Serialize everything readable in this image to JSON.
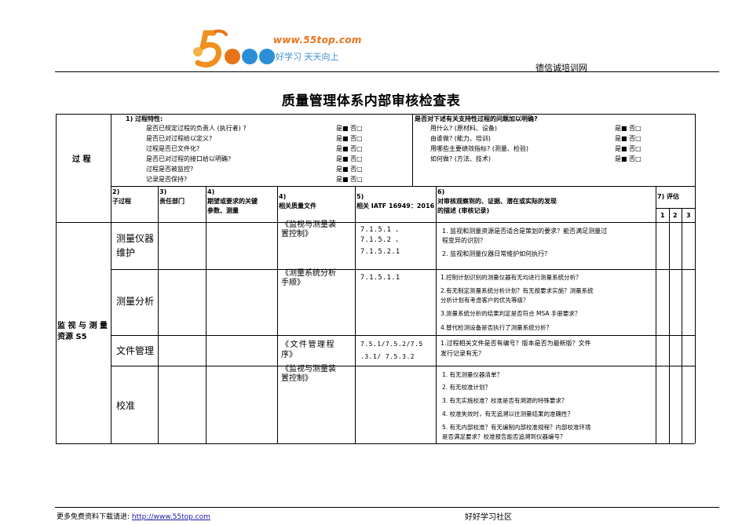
{
  "header": {
    "logo_url": "www.55top.com",
    "logo_slogan": "好好学习  天天向上",
    "site_name": "德信诚培训网"
  },
  "title": "质量管理体系内部审核检查表",
  "process_label": "过 程",
  "left_section": {
    "heading": "1) 过程特性:",
    "items": [
      {
        "q": "是否已规定过程的负责人 (执行者) ?",
        "a": "是■ 否□"
      },
      {
        "q": "是否已对过程给以定义?",
        "a": "是■ 否□"
      },
      {
        "q": "过程是否已文件化?",
        "a": "是■ 否□"
      },
      {
        "q": "是否已对过程的接口给以明确?",
        "a": "是■ 否□"
      },
      {
        "q": "过程是否被监控?",
        "a": "是■ 否□"
      },
      {
        "q": "记录是否保持?",
        "a": "是■ 否□"
      }
    ]
  },
  "right_section": {
    "heading": "是否对下述有关支持性过程的问题加以明确?",
    "items": [
      {
        "q": "用什么? (原材料、设备)",
        "a": "是■ 否□"
      },
      {
        "q": "由谁做? (能力、培训)",
        "a": "是■ 否□"
      },
      {
        "q": "用哪些主要绩效指标? (测量、检验)",
        "a": "是■ 否□"
      },
      {
        "q": "如何做? (方法、技术)",
        "a": "是■ 否□"
      }
    ]
  },
  "columns": {
    "c2": [
      "2)",
      "子过程"
    ],
    "c3": [
      "3)",
      "责任部门"
    ],
    "c4": [
      "4)",
      "期望或要求的关键",
      "参数、测量"
    ],
    "c4b": [
      "4)",
      "相关质量文件"
    ],
    "c5": [
      "5)",
      "相关 IATF 16949：2016"
    ],
    "c6": [
      "6)",
      "对审核观察到的、证据、潜在或实际的发现",
      "的描述 (审核记录)"
    ],
    "c7": "7) 评估",
    "scores": [
      "1",
      "2",
      "3"
    ]
  },
  "group": {
    "line1": "监 视 与 测 量",
    "line2": "资源 S5"
  },
  "rows": [
    {
      "sub": [
        "测量仪器",
        "维护"
      ],
      "doc": [
        "《监视与测量装",
        "置控制》"
      ],
      "clause": [
        "7.1.5.1        、",
        "7.1.5.2        、",
        "7.1.5.2.1"
      ],
      "findings": [
        "1.   监视和测量资源是否适合是策划的要求？能否满足测量过",
        "     程变异的识别？",
        "2.   监视和测量仪器日常维护如何执行？"
      ]
    },
    {
      "sub": [
        "测量分析"
      ],
      "doc": [
        "《测量系统分析",
        "手顺》"
      ],
      "clause": [
        "7.1.5.1.1"
      ],
      "findings": [
        "1.控制计划识别的测量仪器有无均进行测量系统分析？",
        "2.有无制定测量系统分析计划？有无按要求实施？测量系统",
        "分析计划有考虑客户的优先等级？",
        "3.测量系统分析的结果判定是否符合 MSA 手册要求？",
        "4.替代检测设备是否执行了测量系统分析？"
      ]
    },
    {
      "sub": [
        "文件管理"
      ],
      "doc": [
        "《文件管理程",
        "序》"
      ],
      "clause": [
        "7.5.1/7.5.2/7.5",
        ".3.1/ 7.5.3.2"
      ],
      "findings": [
        "   1.过程相关文件是否有编号？版本是否为最新版？文件",
        "发行记录有无？"
      ]
    },
    {
      "sub": [
        "校准"
      ],
      "doc": [
        "《监视与测量装",
        "置控制》"
      ],
      "clause": [],
      "findings": [
        "1.   有无测量仪器清单？",
        "2.   有无校准计划？",
        "3.   有无实施校准？校准是否有溯源的特殊要求？",
        "4.   校准失效时，有无追溯以往测量结果的准确性？",
        "5.   有无内部校准？有无编制内部校准规程？内部校准环境",
        "     是否满足要求？校准报告能否追溯到仪器编号？"
      ]
    }
  ],
  "footer": {
    "left_text": "更多免费资料下载请进:",
    "link": "http://www.55top.com",
    "right_text": "好好学习社区"
  }
}
